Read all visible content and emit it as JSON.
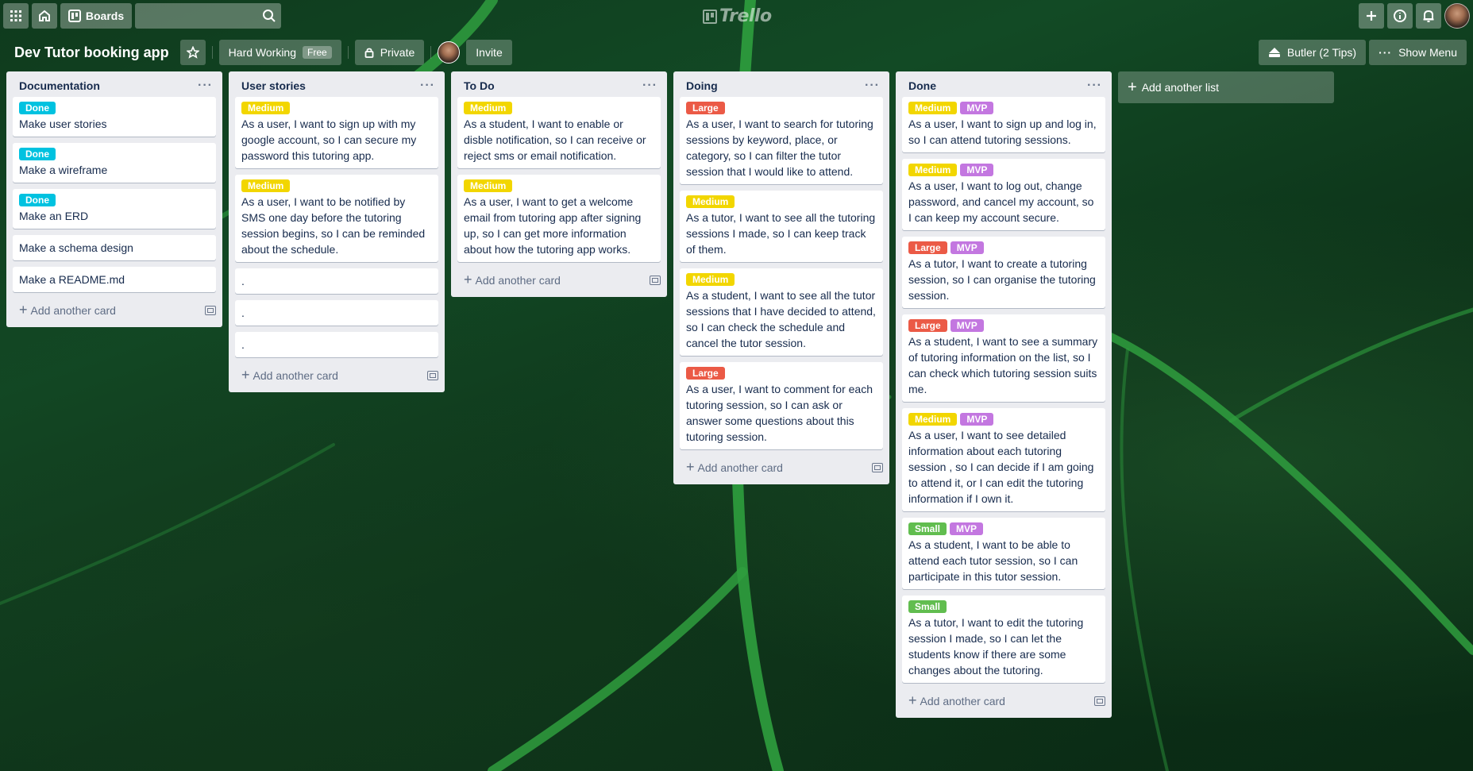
{
  "header": {
    "apps_icon": "grid-icon",
    "home_icon": "home-icon",
    "boards_label": "Boards",
    "search_placeholder": "",
    "logo_text": "Trello",
    "right_icons": [
      "plus-icon",
      "info-icon",
      "bell-icon"
    ]
  },
  "board": {
    "title": "Dev Tutor booking app",
    "team_label": "Hard Working",
    "team_badge": "Free",
    "visibility_label": "Private",
    "invite_label": "Invite",
    "butler_label": "Butler (2 Tips)",
    "menu_label": "Show Menu"
  },
  "label_colors": {
    "Done": "#00c2e0",
    "Medium": "#f2d600",
    "Large": "#eb5a46",
    "Small": "#61bd4f",
    "MVP": "#c377e0"
  },
  "lists": [
    {
      "title": "Documentation",
      "cards": [
        {
          "labels": [
            "Done"
          ],
          "text": "Make user stories"
        },
        {
          "labels": [
            "Done"
          ],
          "text": "Make a wireframe"
        },
        {
          "labels": [
            "Done"
          ],
          "text": "Make an ERD"
        },
        {
          "labels": [],
          "text": "Make a schema design"
        },
        {
          "labels": [],
          "text": "Make a README.md"
        }
      ],
      "add_label": "Add another card"
    },
    {
      "title": "User stories",
      "cards": [
        {
          "labels": [
            "Medium"
          ],
          "text": "As a user, I want to sign up with my google account, so I can secure my password this tutoring app."
        },
        {
          "labels": [
            "Medium"
          ],
          "text": "As a user, I want to be notified by SMS one day before the tutoring session begins, so I can be reminded about the schedule."
        },
        {
          "labels": [],
          "text": "."
        },
        {
          "labels": [],
          "text": "."
        },
        {
          "labels": [],
          "text": "."
        }
      ],
      "add_label": "Add another card"
    },
    {
      "title": "To Do",
      "cards": [
        {
          "labels": [
            "Medium"
          ],
          "text": "As a student, I want to enable or disble notification, so I can receive or reject sms or email notification."
        },
        {
          "labels": [
            "Medium"
          ],
          "text": "As a user, I want to get a welcome email from tutoring app after signing up, so I can get more information about how the tutoring app works."
        }
      ],
      "add_label": "Add another card"
    },
    {
      "title": "Doing",
      "cards": [
        {
          "labels": [
            "Large"
          ],
          "text": "As a user, I want to search for tutoring sessions by keyword, place, or category, so I can filter the tutor session that I would like to attend."
        },
        {
          "labels": [
            "Medium"
          ],
          "text": "As a tutor, I want to see all the tutoring sessions I made, so I can keep track of them."
        },
        {
          "labels": [
            "Medium"
          ],
          "text": "As a student, I want to see all the tutor sessions that I have decided to attend, so I can check the schedule and cancel the tutor session."
        },
        {
          "labels": [
            "Large"
          ],
          "text": "As a user, I want to comment for each tutoring session, so I can ask or answer some questions about this tutoring session."
        }
      ],
      "add_label": "Add another card"
    },
    {
      "title": "Done",
      "cards": [
        {
          "labels": [
            "Medium",
            "MVP"
          ],
          "text": "As a user, I want to sign up and log in, so I can attend tutoring sessions."
        },
        {
          "labels": [
            "Medium",
            "MVP"
          ],
          "text": "As a user, I want to log out, change password, and cancel my account, so I can keep my account secure."
        },
        {
          "labels": [
            "Large",
            "MVP"
          ],
          "text": "As a tutor, I want to create a tutoring session, so I can organise the tutoring session."
        },
        {
          "labels": [
            "Large",
            "MVP"
          ],
          "text": "As a student, I want to see a summary of tutoring information on the list, so I can check which tutoring session suits me."
        },
        {
          "labels": [
            "Medium",
            "MVP"
          ],
          "text": "As a user, I want to see detailed information about each tutoring session , so I can decide if I am going to attend it, or I can edit the tutoring information if I own it."
        },
        {
          "labels": [
            "Small",
            "MVP"
          ],
          "text": "As a student, I want to be able to attend each tutor session, so I can participate in this tutor session."
        },
        {
          "labels": [
            "Small"
          ],
          "text": "As a tutor, I want to edit the tutoring session I made, so I can let the students know if there are some changes about the tutoring."
        }
      ],
      "add_label": "Add another card"
    }
  ],
  "add_list_label": "Add another list"
}
